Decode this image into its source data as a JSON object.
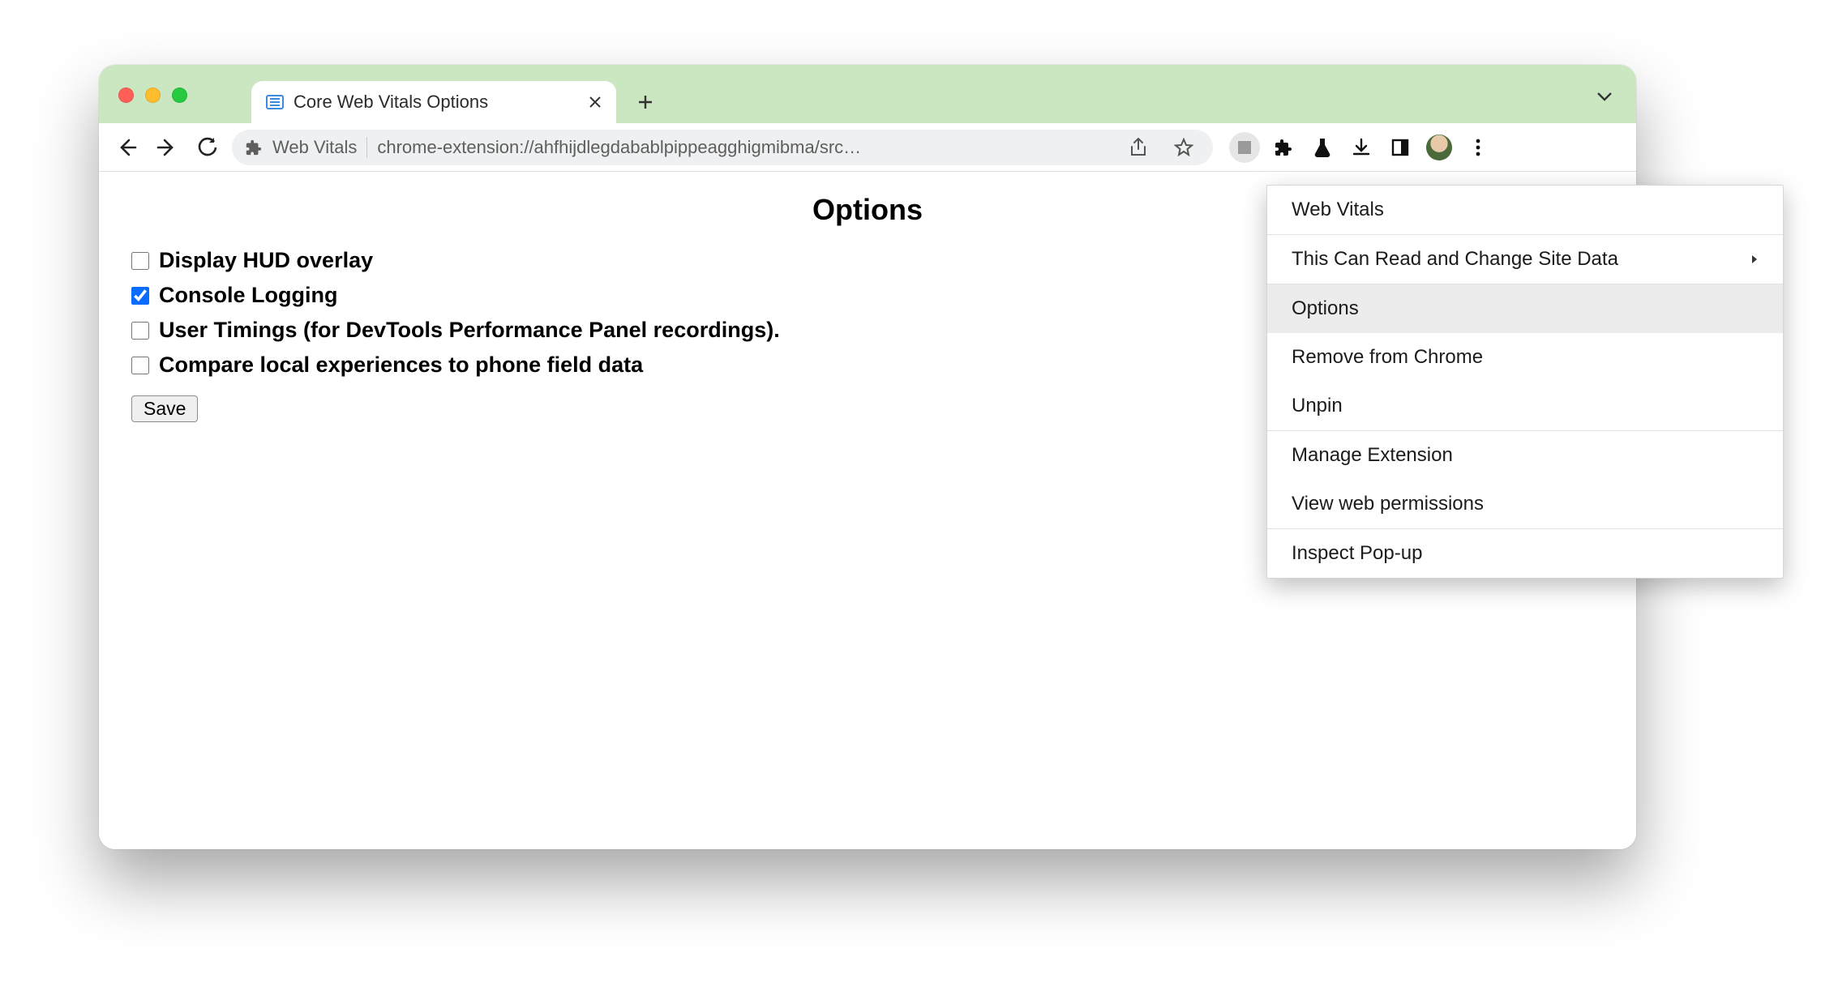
{
  "tab": {
    "title": "Core Web Vitals Options"
  },
  "omnibox": {
    "title": "Web Vitals",
    "url": "chrome-extension://ahfhijdlegdabablpippeagghigmibma/src…"
  },
  "page": {
    "heading": "Options",
    "options": [
      {
        "label": "Display HUD overlay",
        "checked": false
      },
      {
        "label": "Console Logging",
        "checked": true
      },
      {
        "label": "User Timings (for DevTools Performance Panel recordings).",
        "checked": false
      },
      {
        "label": "Compare local experiences to phone field data",
        "checked": false
      }
    ],
    "save_label": "Save"
  },
  "context_menu": {
    "title": "Web Vitals",
    "site_data": "This Can Read and Change Site Data",
    "options": "Options",
    "remove": "Remove from Chrome",
    "unpin": "Unpin",
    "manage": "Manage Extension",
    "view_perms": "View web permissions",
    "inspect": "Inspect Pop-up"
  }
}
